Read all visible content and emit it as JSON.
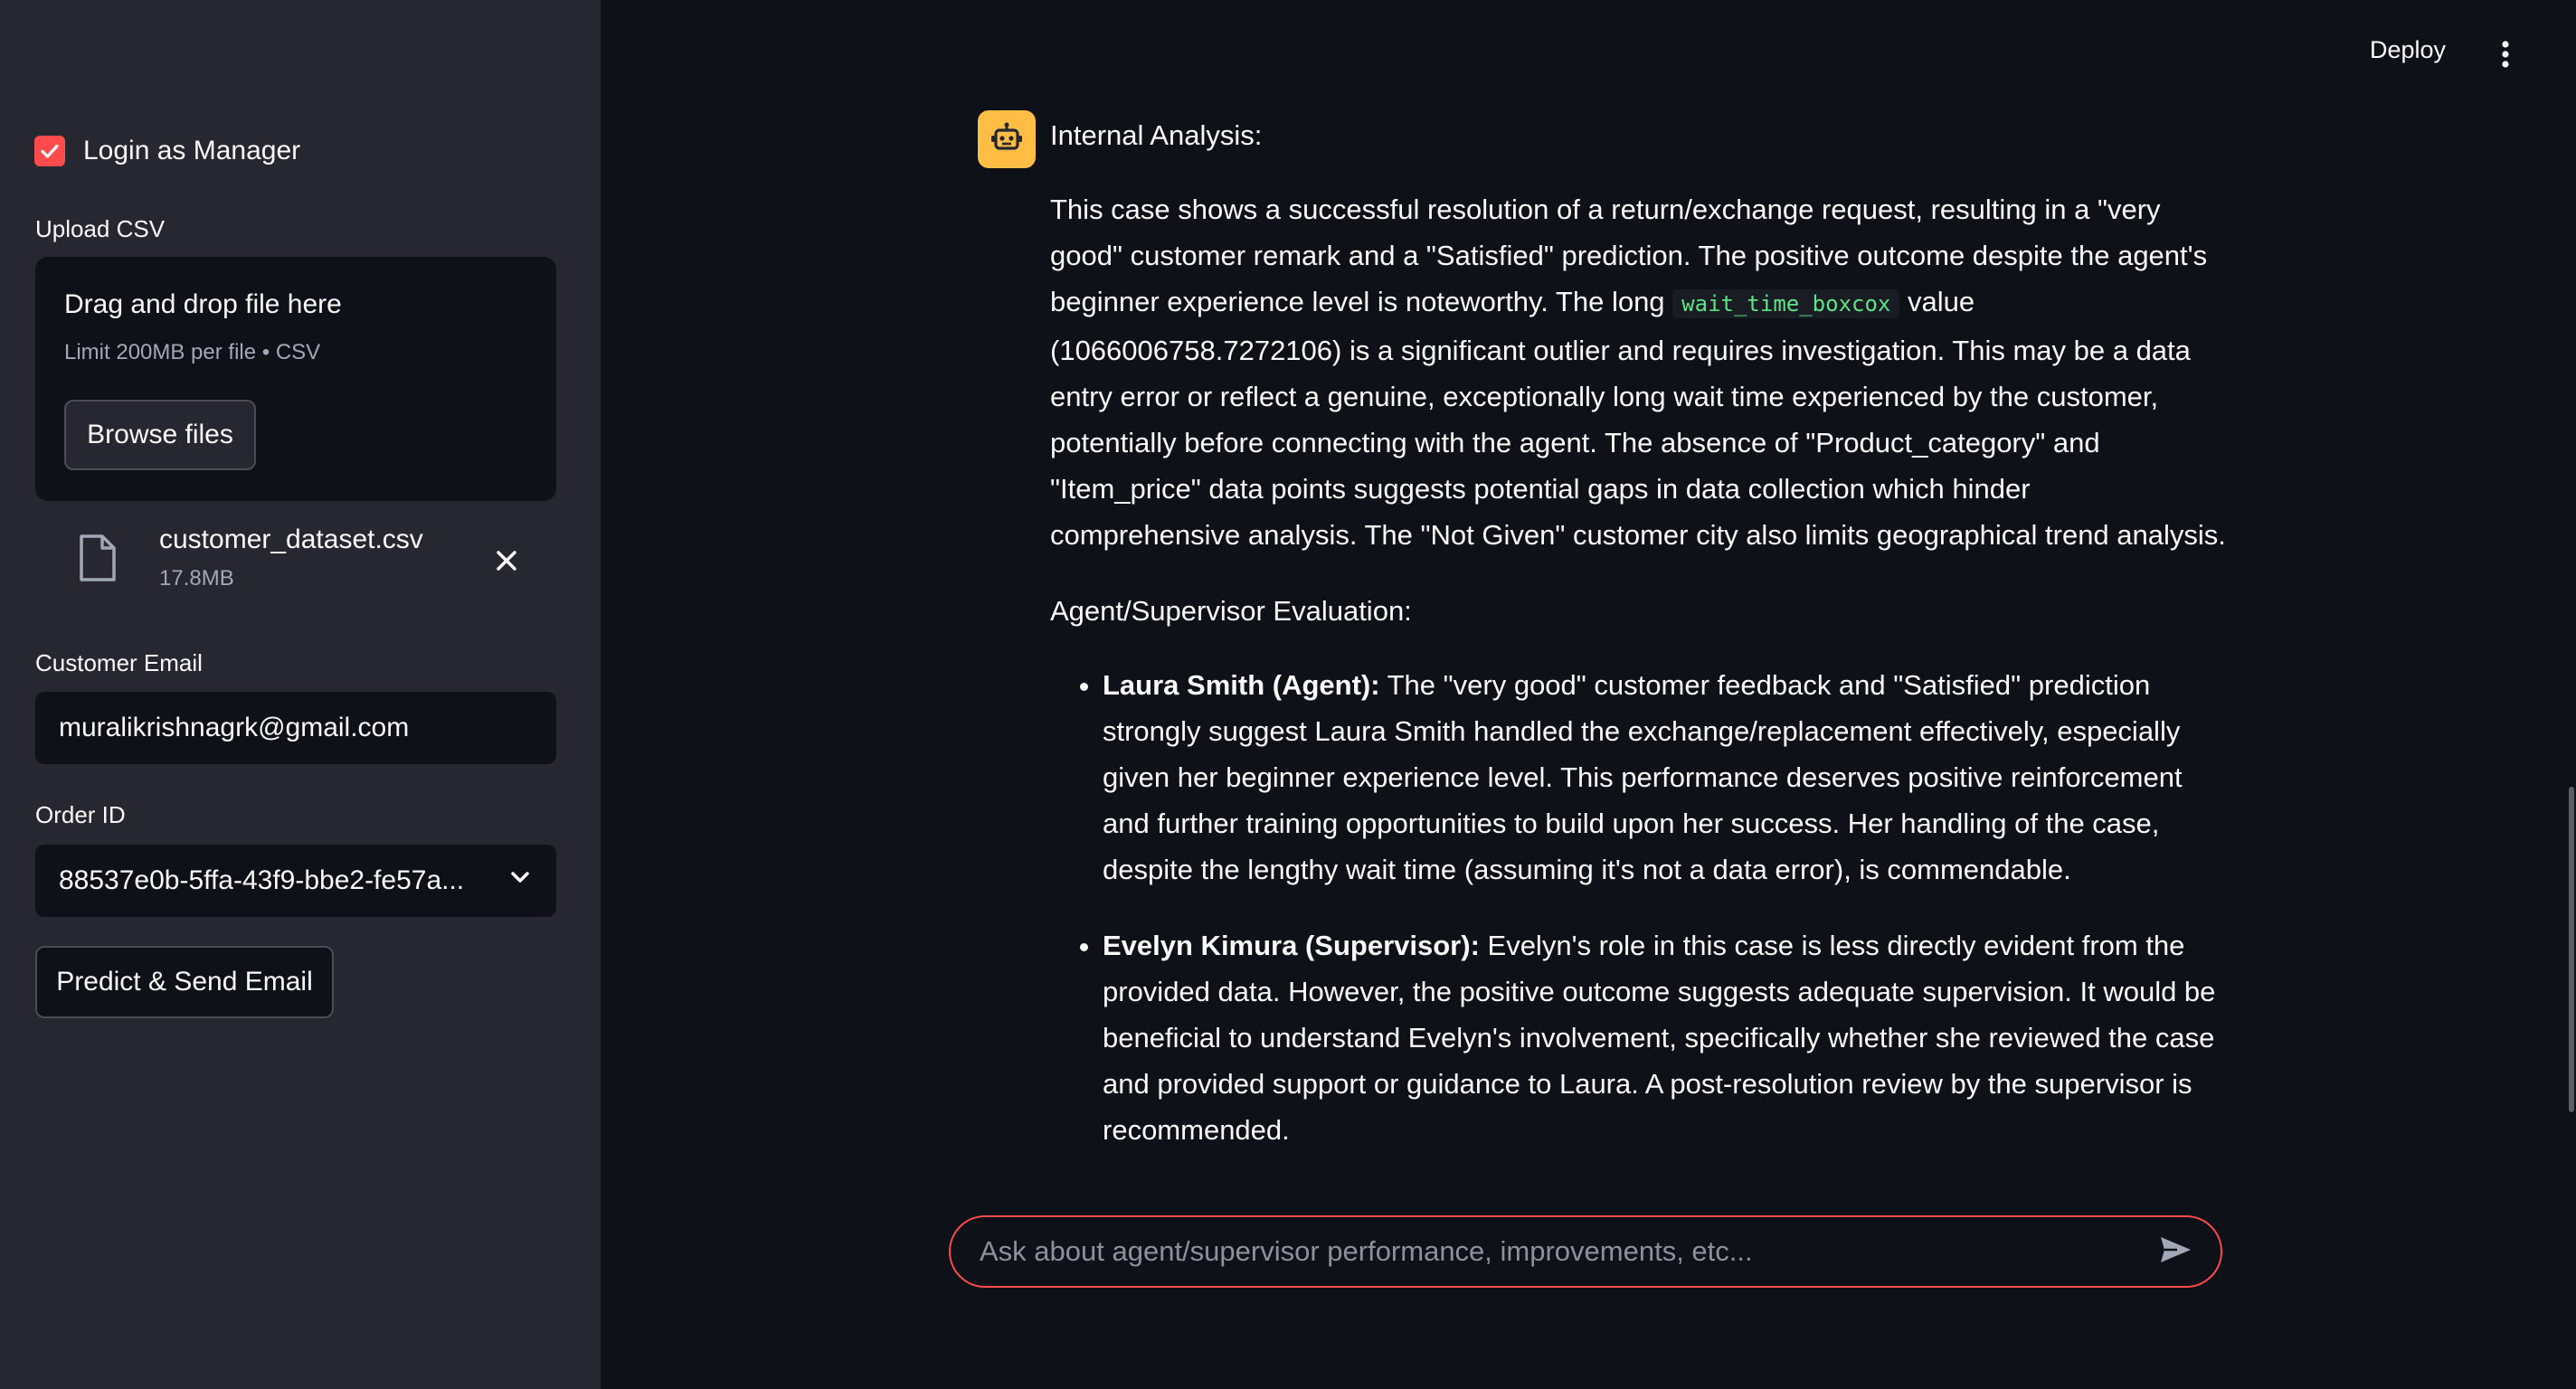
{
  "header": {
    "deploy_label": "Deploy",
    "menu_icon": "more-vert-icon"
  },
  "sidebar": {
    "login_checkbox": {
      "label": "Login as Manager",
      "checked": true,
      "color": "#ff4b4b"
    },
    "upload": {
      "label": "Upload CSV",
      "drop_title": "Drag and drop file here",
      "drop_limit": "Limit 200MB per file • CSV",
      "browse_label": "Browse files",
      "file": {
        "name": "customer_dataset.csv",
        "size": "17.8MB"
      }
    },
    "email": {
      "label": "Customer Email",
      "value": "muralikrishnagrk@gmail.com"
    },
    "order": {
      "label": "Order ID",
      "value": "88537e0b-5ffa-43f9-bbe2-fe57a..."
    },
    "predict_label": "Predict & Send Email"
  },
  "chat": {
    "avatar_icon": "robot-icon",
    "avatar_color": "#ffbd45",
    "heading": "Internal Analysis:",
    "analysis": {
      "pre": "This case shows a successful resolution of a return/exchange request, resulting in a \"very good\" customer remark and a \"Satisfied\" prediction. The positive outcome despite the agent's beginner experience level is noteworthy. The long ",
      "code": "wait_time_boxcox",
      "post": " value (1066006758.7272106) is a significant outlier and requires investigation. This may be a data entry error or reflect a genuine, exceptionally long wait time experienced by the customer, potentially before connecting with the agent. The absence of \"Product_category\" and \"Item_price\" data points suggests potential gaps in data collection which hinder comprehensive analysis. The \"Not Given\" customer city also limits geographical trend analysis."
    },
    "eval_heading": "Agent/Supervisor Evaluation:",
    "evaluations": [
      {
        "name": "Laura Smith (Agent):",
        "text": " The \"very good\" customer feedback and \"Satisfied\" prediction strongly suggest Laura Smith handled the exchange/replacement effectively, especially given her beginner experience level. This performance deserves positive reinforcement and further training opportunities to build upon her success. Her handling of the case, despite the lengthy wait time (assuming it's not a data error), is commendable."
      },
      {
        "name": "Evelyn Kimura (Supervisor):",
        "text": " Evelyn's role in this case is less directly evident from the provided data. However, the positive outcome suggests adequate supervision. It would be beneficial to understand Evelyn's involvement, specifically whether she reviewed the case and provided support or guidance to Laura. A post-resolution review by the supervisor is recommended."
      }
    ],
    "input_placeholder": "Ask about agent/supervisor performance, improvements, etc..."
  }
}
